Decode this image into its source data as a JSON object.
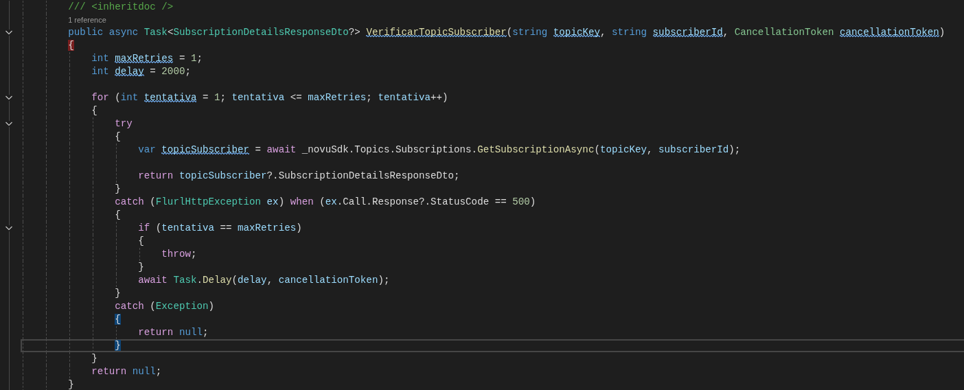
{
  "editor": {
    "lines": [
      {
        "kind": "code",
        "fold": false,
        "current": false,
        "tokens": [
          {
            "text": "        /// <inheritdoc />",
            "kind": "comment",
            "squiggle": false
          }
        ]
      },
      {
        "kind": "codelens",
        "text": "1 reference"
      },
      {
        "kind": "code",
        "fold": true,
        "current": false,
        "tokens": [
          {
            "text": "        public",
            "kind": "kw",
            "squiggle": false
          },
          {
            "text": " async",
            "kind": "kw",
            "squiggle": false
          },
          {
            "text": " Task",
            "kind": "type",
            "squiggle": false
          },
          {
            "text": "<",
            "kind": "plain",
            "squiggle": false
          },
          {
            "text": "SubscriptionDetailsResponseDto",
            "kind": "type",
            "squiggle": false
          },
          {
            "text": "?> ",
            "kind": "plain",
            "squiggle": false
          },
          {
            "text": "VerificarTopicSubscriber",
            "kind": "method",
            "squiggle": true
          },
          {
            "text": "(",
            "kind": "plain",
            "squiggle": false
          },
          {
            "text": "string",
            "kind": "kw",
            "squiggle": false
          },
          {
            "text": " topicKey",
            "kind": "id",
            "squiggle": true
          },
          {
            "text": ", ",
            "kind": "plain",
            "squiggle": false
          },
          {
            "text": "string",
            "kind": "kw",
            "squiggle": false
          },
          {
            "text": " subscriberId",
            "kind": "id",
            "squiggle": true
          },
          {
            "text": ", ",
            "kind": "plain",
            "squiggle": false
          },
          {
            "text": "CancellationToken",
            "kind": "struct",
            "squiggle": false
          },
          {
            "text": " cancellationToken",
            "kind": "id",
            "squiggle": true
          },
          {
            "text": ")",
            "kind": "plain",
            "squiggle": false
          }
        ]
      },
      {
        "kind": "code",
        "fold": false,
        "current": false,
        "tokens": [
          {
            "text": "        {",
            "kind": "errorbrace",
            "squiggle": false
          }
        ]
      },
      {
        "kind": "code",
        "fold": false,
        "current": false,
        "tokens": [
          {
            "text": "            int",
            "kind": "kw",
            "squiggle": false
          },
          {
            "text": " maxRetries",
            "kind": "id",
            "squiggle": true
          },
          {
            "text": " = ",
            "kind": "plain",
            "squiggle": false
          },
          {
            "text": "1",
            "kind": "num",
            "squiggle": false
          },
          {
            "text": ";",
            "kind": "plain",
            "squiggle": false
          }
        ]
      },
      {
        "kind": "code",
        "fold": false,
        "current": false,
        "tokens": [
          {
            "text": "            int",
            "kind": "kw",
            "squiggle": false
          },
          {
            "text": " delay",
            "kind": "id",
            "squiggle": true
          },
          {
            "text": " = ",
            "kind": "plain",
            "squiggle": false
          },
          {
            "text": "2000",
            "kind": "num",
            "squiggle": false
          },
          {
            "text": ";",
            "kind": "plain",
            "squiggle": false
          }
        ]
      },
      {
        "kind": "blank"
      },
      {
        "kind": "code",
        "fold": true,
        "current": false,
        "tokens": [
          {
            "text": "            for",
            "kind": "ctrl",
            "squiggle": false
          },
          {
            "text": " (",
            "kind": "plain",
            "squiggle": false
          },
          {
            "text": "int",
            "kind": "kw",
            "squiggle": false
          },
          {
            "text": " tentativa",
            "kind": "id",
            "squiggle": true
          },
          {
            "text": " = ",
            "kind": "plain",
            "squiggle": false
          },
          {
            "text": "1",
            "kind": "num",
            "squiggle": false
          },
          {
            "text": "; ",
            "kind": "plain",
            "squiggle": false
          },
          {
            "text": "tentativa",
            "kind": "id",
            "squiggle": false
          },
          {
            "text": " <= ",
            "kind": "plain",
            "squiggle": false
          },
          {
            "text": "maxRetries",
            "kind": "id",
            "squiggle": false
          },
          {
            "text": "; ",
            "kind": "plain",
            "squiggle": false
          },
          {
            "text": "tentativa",
            "kind": "id",
            "squiggle": false
          },
          {
            "text": "++)",
            "kind": "plain",
            "squiggle": false
          }
        ]
      },
      {
        "kind": "code",
        "fold": false,
        "current": false,
        "tokens": [
          {
            "text": "            {",
            "kind": "plain",
            "squiggle": false
          }
        ]
      },
      {
        "kind": "code",
        "fold": true,
        "current": false,
        "tokens": [
          {
            "text": "                try",
            "kind": "ctrl",
            "squiggle": false
          }
        ]
      },
      {
        "kind": "code",
        "fold": false,
        "current": false,
        "tokens": [
          {
            "text": "                {",
            "kind": "plain",
            "squiggle": false
          }
        ]
      },
      {
        "kind": "code",
        "fold": false,
        "current": false,
        "tokens": [
          {
            "text": "                    var",
            "kind": "kw",
            "squiggle": false
          },
          {
            "text": " topicSubscriber",
            "kind": "id",
            "squiggle": true
          },
          {
            "text": " = ",
            "kind": "plain",
            "squiggle": false
          },
          {
            "text": "await",
            "kind": "ctrl",
            "squiggle": false
          },
          {
            "text": " _novuSdk.Topics.Subscriptions.",
            "kind": "plain",
            "squiggle": false
          },
          {
            "text": "GetSubscriptionAsync",
            "kind": "method",
            "squiggle": false
          },
          {
            "text": "(",
            "kind": "plain",
            "squiggle": false
          },
          {
            "text": "topicKey",
            "kind": "id",
            "squiggle": false
          },
          {
            "text": ", ",
            "kind": "plain",
            "squiggle": false
          },
          {
            "text": "subscriberId",
            "kind": "id",
            "squiggle": false
          },
          {
            "text": ");",
            "kind": "plain",
            "squiggle": false
          }
        ]
      },
      {
        "kind": "blank"
      },
      {
        "kind": "code",
        "fold": false,
        "current": false,
        "tokens": [
          {
            "text": "                    return",
            "kind": "ctrl",
            "squiggle": false
          },
          {
            "text": " topicSubscriber",
            "kind": "id",
            "squiggle": false
          },
          {
            "text": "?.SubscriptionDetailsResponseDto;",
            "kind": "plain",
            "squiggle": false
          }
        ]
      },
      {
        "kind": "code",
        "fold": false,
        "current": false,
        "tokens": [
          {
            "text": "                }",
            "kind": "plain",
            "squiggle": false
          }
        ]
      },
      {
        "kind": "code",
        "fold": false,
        "current": false,
        "tokens": [
          {
            "text": "                catch",
            "kind": "ctrl",
            "squiggle": false
          },
          {
            "text": " (",
            "kind": "plain",
            "squiggle": false
          },
          {
            "text": "FlurlHttpException",
            "kind": "type",
            "squiggle": false
          },
          {
            "text": " ex",
            "kind": "id",
            "squiggle": false
          },
          {
            "text": ") ",
            "kind": "plain",
            "squiggle": false
          },
          {
            "text": "when",
            "kind": "ctrl",
            "squiggle": false
          },
          {
            "text": " (",
            "kind": "plain",
            "squiggle": false
          },
          {
            "text": "ex",
            "kind": "id",
            "squiggle": false
          },
          {
            "text": ".Call.Response?.StatusCode == ",
            "kind": "plain",
            "squiggle": false
          },
          {
            "text": "500",
            "kind": "num",
            "squiggle": false
          },
          {
            "text": ")",
            "kind": "plain",
            "squiggle": false
          }
        ]
      },
      {
        "kind": "code",
        "fold": false,
        "current": false,
        "tokens": [
          {
            "text": "                {",
            "kind": "plain",
            "squiggle": false
          }
        ]
      },
      {
        "kind": "code",
        "fold": true,
        "current": false,
        "tokens": [
          {
            "text": "                    if",
            "kind": "ctrl",
            "squiggle": false
          },
          {
            "text": " (",
            "kind": "plain",
            "squiggle": false
          },
          {
            "text": "tentativa",
            "kind": "id",
            "squiggle": false
          },
          {
            "text": " == ",
            "kind": "plain",
            "squiggle": false
          },
          {
            "text": "maxRetries",
            "kind": "id",
            "squiggle": false
          },
          {
            "text": ")",
            "kind": "plain",
            "squiggle": false
          }
        ]
      },
      {
        "kind": "code",
        "fold": false,
        "current": false,
        "tokens": [
          {
            "text": "                    {",
            "kind": "plain",
            "squiggle": false
          }
        ]
      },
      {
        "kind": "code",
        "fold": false,
        "current": false,
        "tokens": [
          {
            "text": "                        throw",
            "kind": "ctrl",
            "squiggle": false
          },
          {
            "text": ";",
            "kind": "plain",
            "squiggle": false
          }
        ]
      },
      {
        "kind": "code",
        "fold": false,
        "current": false,
        "tokens": [
          {
            "text": "                    }",
            "kind": "plain",
            "squiggle": false
          }
        ]
      },
      {
        "kind": "code",
        "fold": false,
        "current": false,
        "tokens": [
          {
            "text": "                    await",
            "kind": "ctrl",
            "squiggle": false
          },
          {
            "text": " Task",
            "kind": "type",
            "squiggle": false
          },
          {
            "text": ".",
            "kind": "plain",
            "squiggle": false
          },
          {
            "text": "Delay",
            "kind": "method",
            "squiggle": false
          },
          {
            "text": "(",
            "kind": "plain",
            "squiggle": false
          },
          {
            "text": "delay",
            "kind": "id",
            "squiggle": false
          },
          {
            "text": ", ",
            "kind": "plain",
            "squiggle": false
          },
          {
            "text": "cancellationToken",
            "kind": "id",
            "squiggle": false
          },
          {
            "text": ");",
            "kind": "plain",
            "squiggle": false
          }
        ]
      },
      {
        "kind": "code",
        "fold": false,
        "current": false,
        "tokens": [
          {
            "text": "                }",
            "kind": "plain",
            "squiggle": false
          }
        ]
      },
      {
        "kind": "code",
        "fold": false,
        "current": false,
        "tokens": [
          {
            "text": "                catch",
            "kind": "ctrl",
            "squiggle": false
          },
          {
            "text": " (",
            "kind": "plain",
            "squiggle": false
          },
          {
            "text": "Exception",
            "kind": "type",
            "squiggle": false
          },
          {
            "text": ")",
            "kind": "plain",
            "squiggle": false
          }
        ]
      },
      {
        "kind": "code",
        "fold": false,
        "current": false,
        "tokens": [
          {
            "text": "                {",
            "kind": "matchbrace",
            "squiggle": false
          }
        ]
      },
      {
        "kind": "code",
        "fold": false,
        "current": false,
        "tokens": [
          {
            "text": "                    return",
            "kind": "ctrl",
            "squiggle": false
          },
          {
            "text": " null",
            "kind": "kw",
            "squiggle": false
          },
          {
            "text": ";",
            "kind": "plain",
            "squiggle": false
          }
        ]
      },
      {
        "kind": "code",
        "fold": false,
        "current": true,
        "tokens": [
          {
            "text": "                }",
            "kind": "matchbrace",
            "squiggle": false
          }
        ]
      },
      {
        "kind": "code",
        "fold": false,
        "current": false,
        "tokens": [
          {
            "text": "            }",
            "kind": "plain",
            "squiggle": false
          }
        ]
      },
      {
        "kind": "code",
        "fold": false,
        "current": false,
        "tokens": [
          {
            "text": "            return",
            "kind": "ctrl",
            "squiggle": false
          },
          {
            "text": " null",
            "kind": "kw",
            "squiggle": false
          },
          {
            "text": ";",
            "kind": "plain",
            "squiggle": false
          }
        ]
      },
      {
        "kind": "code",
        "fold": false,
        "current": false,
        "tokens": [
          {
            "text": "        }",
            "kind": "plain",
            "squiggle": false
          }
        ]
      }
    ]
  }
}
